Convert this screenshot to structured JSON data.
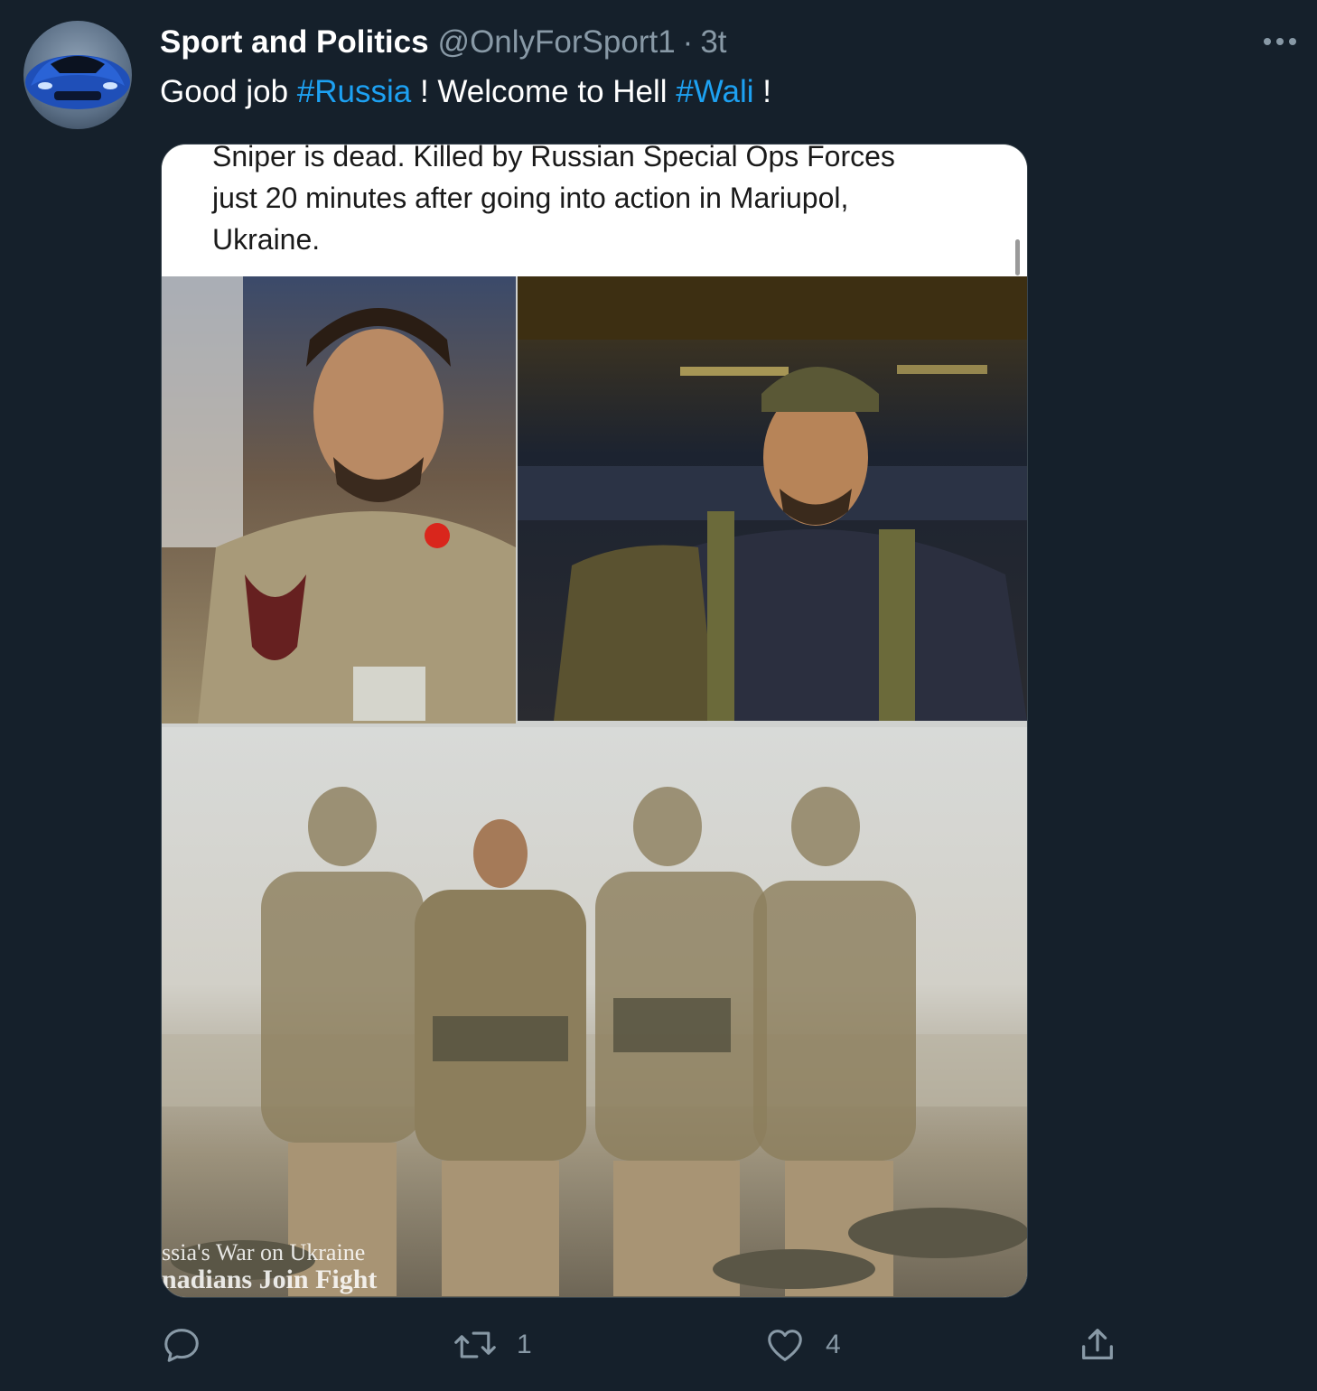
{
  "tweet": {
    "author_name": "Sport and Politics",
    "author_handle": "@OnlyForSport1",
    "separator": "·",
    "time": "3t",
    "text_parts": [
      {
        "text": "Good job ",
        "hashtag": false
      },
      {
        "text": "#Russia",
        "hashtag": true
      },
      {
        "text": " ! Welcome to Hell ",
        "hashtag": false
      },
      {
        "text": "#Wali",
        "hashtag": true
      },
      {
        "text": " !",
        "hashtag": false
      }
    ]
  },
  "media": {
    "caption_lines": [
      "Sniper is dead. Killed by Russian Special Ops Forces",
      "just 20 minutes after going into action in Mariupol,",
      "Ukraine."
    ],
    "watermark_line1": "ssia's War on Ukraine",
    "watermark_line2": "nadians Join Fight"
  },
  "actions": {
    "reply_count": "",
    "retweet_count": "1",
    "like_count": "4"
  },
  "colors": {
    "background": "#15202b",
    "accent": "#1da1f2",
    "secondary_text": "#8899a6"
  },
  "icons": [
    "more-icon",
    "reply-icon",
    "retweet-icon",
    "like-icon",
    "share-icon"
  ]
}
